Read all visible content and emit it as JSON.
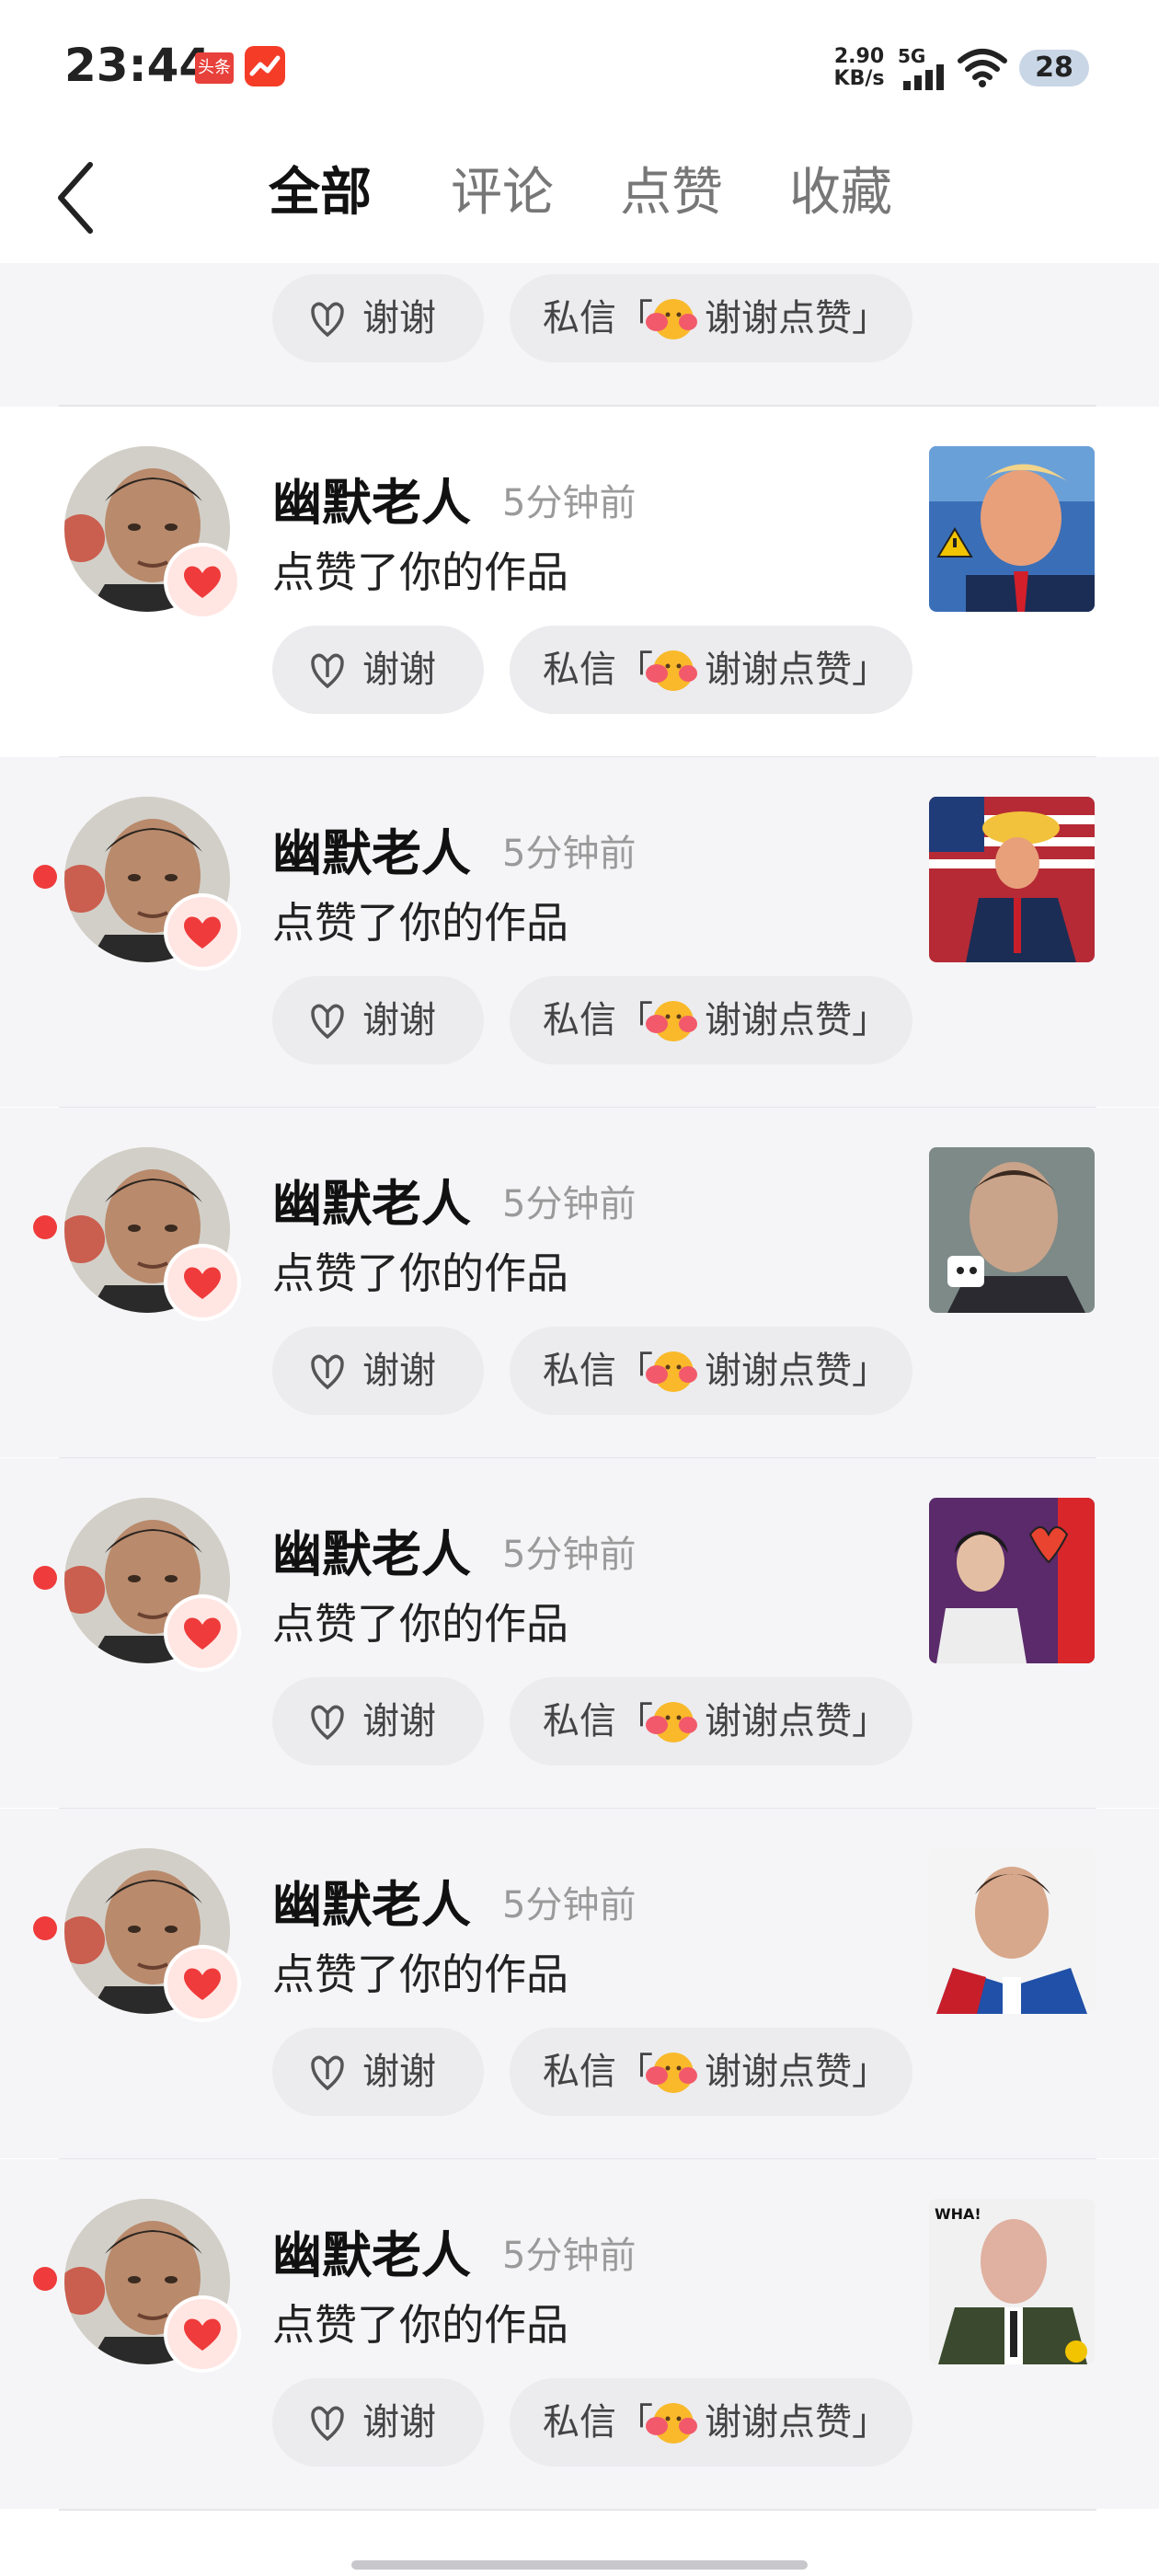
{
  "status_bar": {
    "time": "23:44",
    "app_badge_1": "头条",
    "net_speed_value": "2.90",
    "net_speed_unit": "KB/s",
    "network": "5G",
    "battery": "28"
  },
  "nav": {
    "tabs": [
      {
        "label": "全部",
        "active": true
      },
      {
        "label": "评论",
        "active": false
      },
      {
        "label": "点赞",
        "active": false
      },
      {
        "label": "收藏",
        "active": false
      }
    ]
  },
  "buttons": {
    "thanks": "谢谢",
    "message_prefix": "私信「",
    "message_suffix": "谢谢点赞」"
  },
  "notifications": [
    {
      "name": "幽默老人",
      "time": "5分钟前",
      "action": "点赞了你的作品",
      "unread": false,
      "thumb_icon": "politician-thumbnail-1"
    },
    {
      "name": "幽默老人",
      "time": "5分钟前",
      "action": "点赞了你的作品",
      "unread": true,
      "thumb_icon": "politician-thumbnail-2"
    },
    {
      "name": "幽默老人",
      "time": "5分钟前",
      "action": "点赞了你的作品",
      "unread": true,
      "thumb_icon": "politician-thumbnail-3"
    },
    {
      "name": "幽默老人",
      "time": "5分钟前",
      "action": "点赞了你的作品",
      "unread": true,
      "thumb_icon": "politician-thumbnail-4"
    },
    {
      "name": "幽默老人",
      "time": "5分钟前",
      "action": "点赞了你的作品",
      "unread": true,
      "thumb_icon": "politician-thumbnail-5"
    },
    {
      "name": "幽默老人",
      "time": "5分钟前",
      "action": "点赞了你的作品",
      "unread": true,
      "thumb_icon": "politician-thumbnail-6"
    }
  ],
  "colors": {
    "accent_red": "#ef3b3b",
    "unread_bg": "#f5f5f7",
    "button_bg": "#ececef"
  }
}
